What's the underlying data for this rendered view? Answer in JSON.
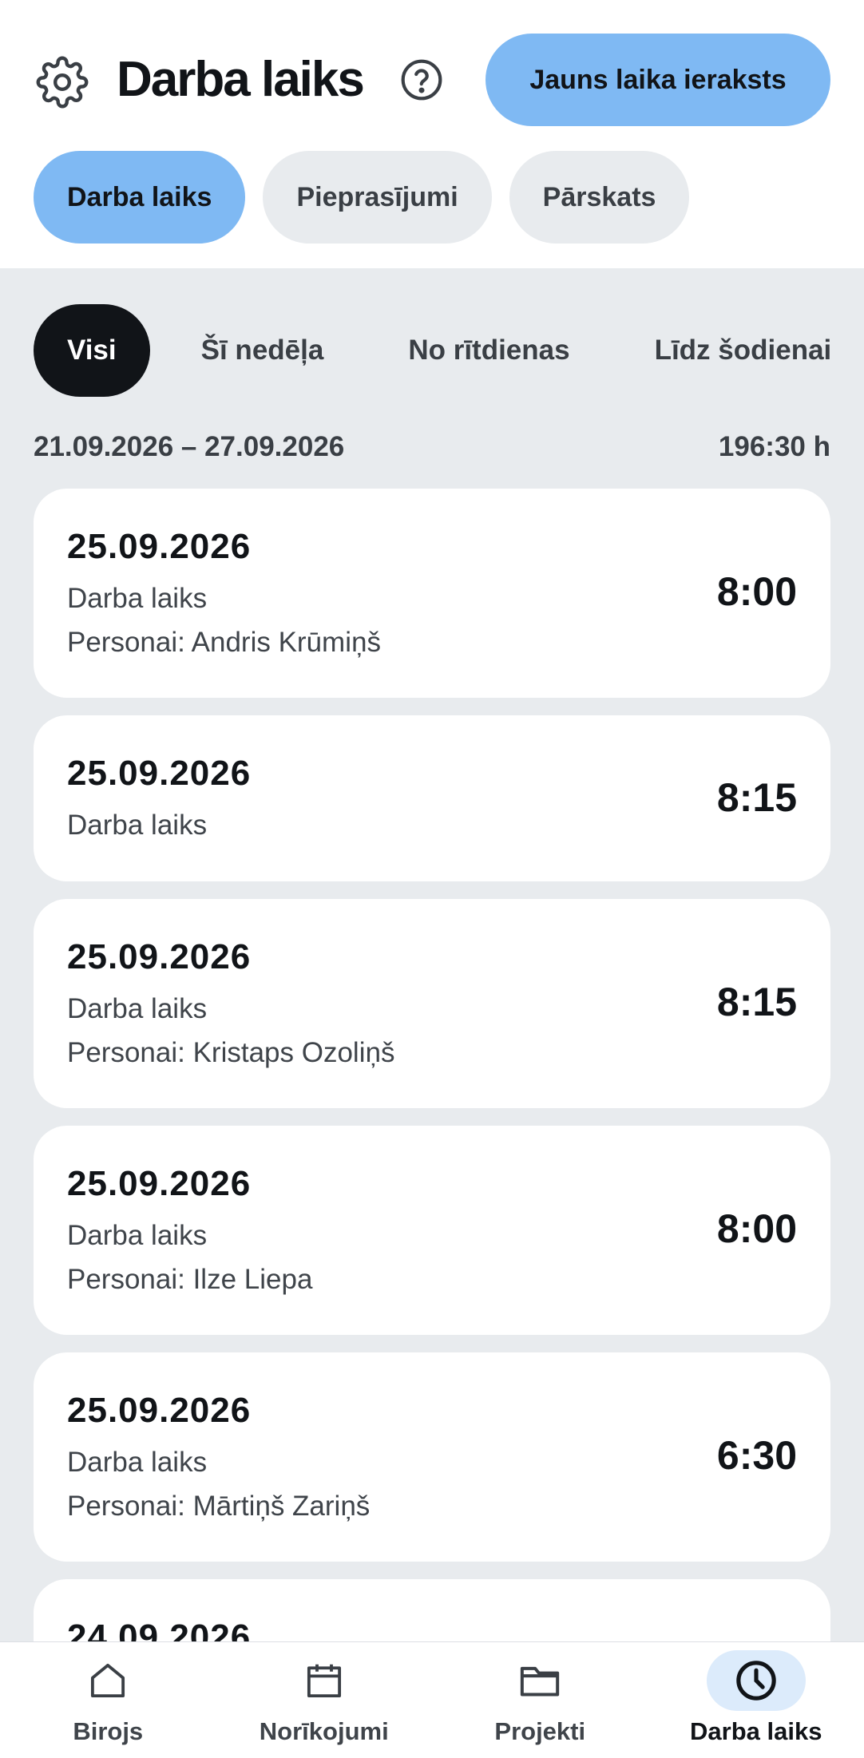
{
  "header": {
    "title": "Darba laiks",
    "new_entry_label": "Jauns laika ieraksts",
    "settings_icon": "gear-icon",
    "help_icon": "help-circle-icon"
  },
  "tabs": [
    {
      "label": "Darba laiks",
      "active": true
    },
    {
      "label": "Pieprasījumi",
      "active": false
    },
    {
      "label": "Pārskats",
      "active": false
    }
  ],
  "filters": [
    {
      "label": "Visi",
      "active": true
    },
    {
      "label": "Šī nedēļa",
      "active": false
    },
    {
      "label": "No rītdienas",
      "active": false
    },
    {
      "label": "Līdz šodienai",
      "active": false
    }
  ],
  "period": {
    "range": "21.09.2026 – 27.09.2026",
    "total": "196:30 h"
  },
  "entries": [
    {
      "date": "25.09.2026",
      "type": "Darba laiks",
      "person": "Personai: Andris Krūmiņš",
      "hours": "8:00"
    },
    {
      "date": "25.09.2026",
      "type": "Darba laiks",
      "person": "",
      "hours": "8:15"
    },
    {
      "date": "25.09.2026",
      "type": "Darba laiks",
      "person": "Personai: Kristaps Ozoliņš",
      "hours": "8:15"
    },
    {
      "date": "25.09.2026",
      "type": "Darba laiks",
      "person": "Personai: Ilze Liepa",
      "hours": "8:00"
    },
    {
      "date": "25.09.2026",
      "type": "Darba laiks",
      "person": "Personai: Mārtiņš Zariņš",
      "hours": "6:30"
    },
    {
      "date": "24.09.2026",
      "type": "",
      "person": "",
      "hours": ""
    }
  ],
  "bottom_nav": [
    {
      "label": "Birojs",
      "icon": "home-icon",
      "active": false
    },
    {
      "label": "Norīkojumi",
      "icon": "calendar-icon",
      "active": false
    },
    {
      "label": "Projekti",
      "icon": "folder-icon",
      "active": false
    },
    {
      "label": "Darba laiks",
      "icon": "clock-icon",
      "active": true
    }
  ],
  "colors": {
    "accent": "#7fb9f3",
    "active_chip": "#111418",
    "background_gray": "#e8ebee",
    "nav_active_bg": "#dcebfb"
  }
}
